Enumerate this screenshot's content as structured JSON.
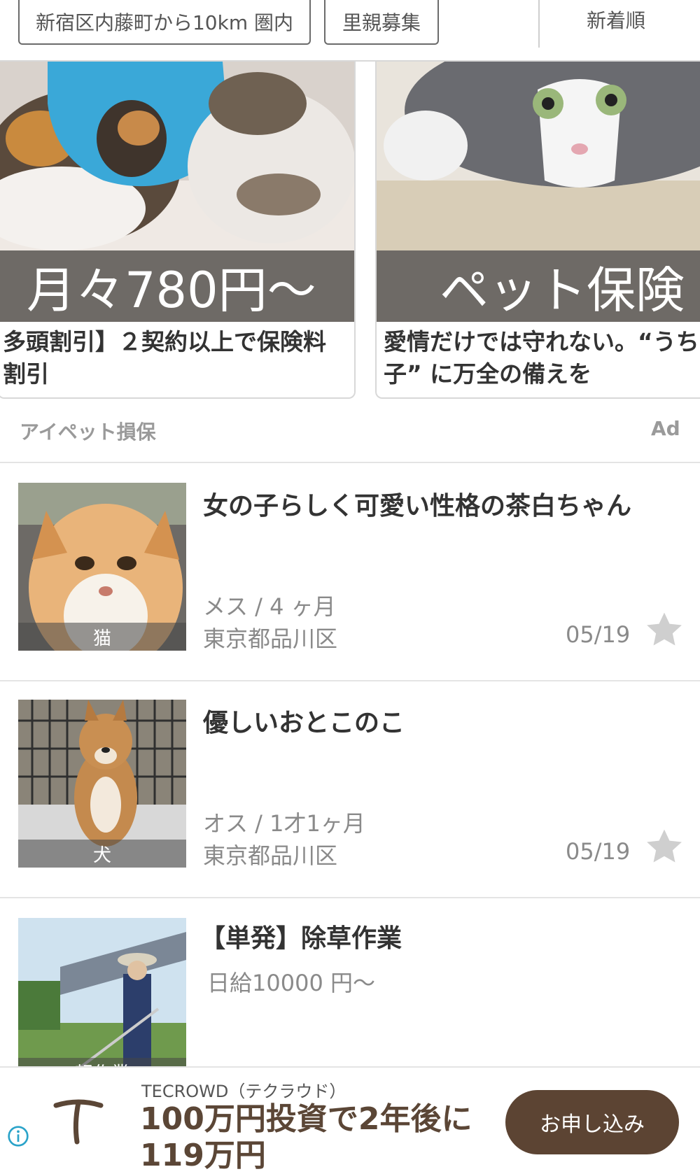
{
  "filters": {
    "location": "新宿区内藤町から10km 圏内",
    "category": "里親募集",
    "sort": "新着順"
  },
  "ad_carousel": {
    "cards": [
      {
        "band_text": "月々780円〜",
        "text_line1": "多頭割引】２契約以上で保険料",
        "text_line2": "割引"
      },
      {
        "band_text": "ペット保険",
        "text_line1": "愛情だけでは守れない。“うち",
        "text_line2": "子” に万全の備えを"
      }
    ],
    "sponsor": "アイペット損保",
    "ad_label": "Ad"
  },
  "listings": [
    {
      "title": "女の子らしく可愛い性格の茶白ちゃん",
      "kind": "猫",
      "gender_age": "メス / 4 ヶ月",
      "location": "東京都品川区",
      "date": "05/19"
    },
    {
      "title": "優しいおとこのこ",
      "kind": "犬",
      "gender_age": "オス / 1才1ヶ月",
      "location": "東京都品川区",
      "date": "05/19"
    },
    {
      "title": "【単発】除草作業",
      "kind": "軽作業",
      "wage": "日給10000 円〜"
    }
  ],
  "bottom_ad": {
    "sponsor": "TECROWD（テクラウド）",
    "headline_line1": "100万円投資で2年後に",
    "headline_line2": "119万円",
    "cta": "お申し込み",
    "colors": {
      "cta_bg": "#5c4433",
      "headline": "#5b4636"
    }
  }
}
